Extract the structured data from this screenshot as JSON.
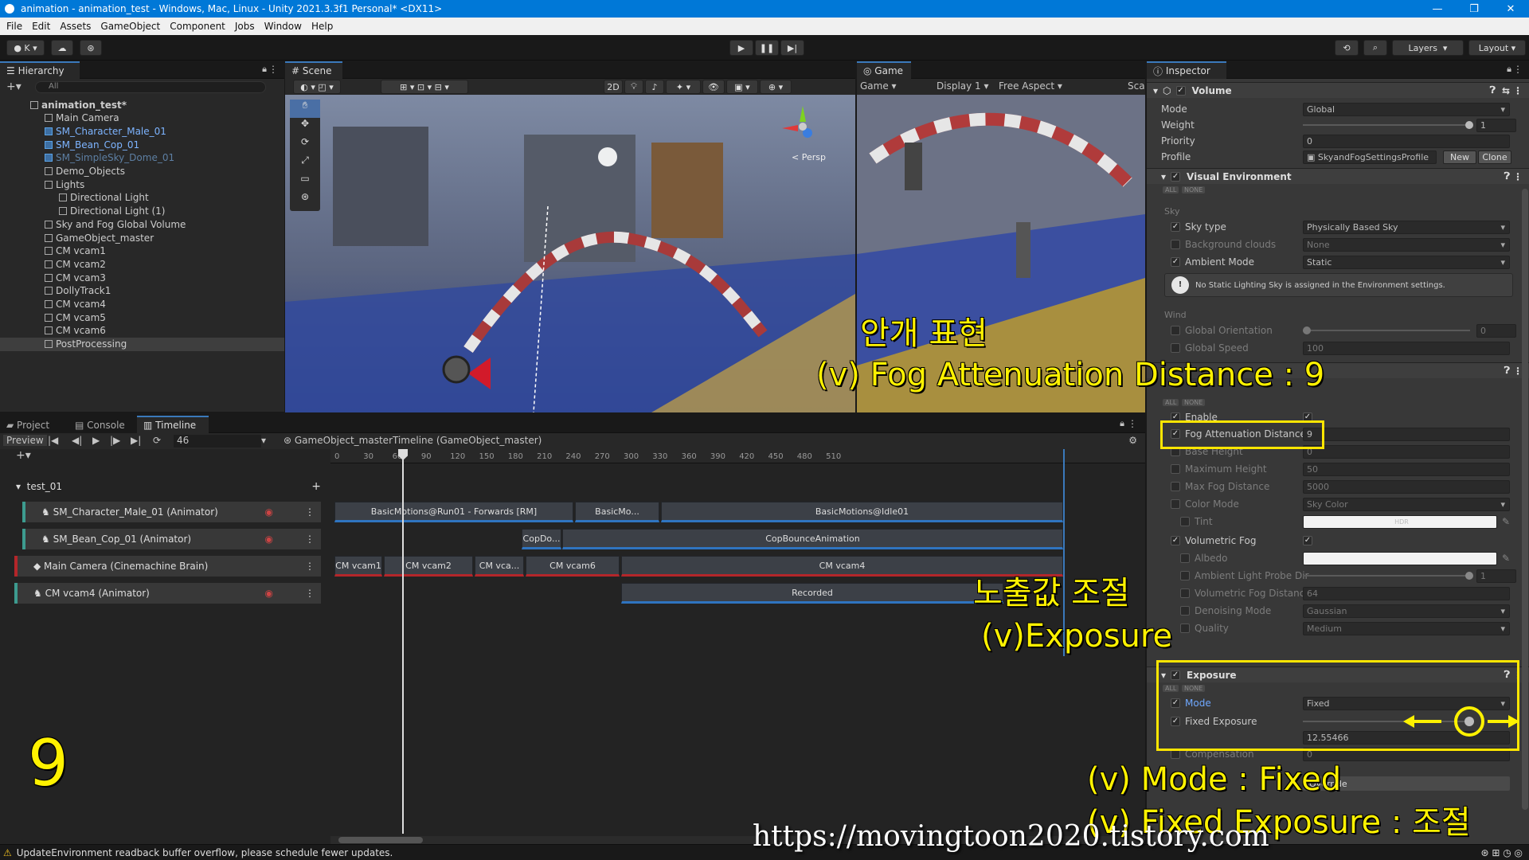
{
  "window": {
    "title": "animation - animation_test - Windows, Mac, Linux - Unity 2021.3.3f1 Personal* <DX11>"
  },
  "menu": [
    "File",
    "Edit",
    "Assets",
    "GameObject",
    "Component",
    "Jobs",
    "Window",
    "Help"
  ],
  "toolbar": {
    "account": "K",
    "layers": "Layers",
    "layout": "Layout"
  },
  "hierarchy": {
    "tab": "Hierarchy",
    "search_placeholder": "All",
    "items": [
      {
        "label": "animation_test*",
        "depth": 0,
        "kind": "scene"
      },
      {
        "label": "Main Camera",
        "depth": 1,
        "kind": "object"
      },
      {
        "label": "SM_Character_Male_01",
        "depth": 1,
        "kind": "prefab"
      },
      {
        "label": "SM_Bean_Cop_01",
        "depth": 1,
        "kind": "prefab"
      },
      {
        "label": "SM_SimpleSky_Dome_01",
        "depth": 1,
        "kind": "faded"
      },
      {
        "label": "Demo_Objects",
        "depth": 1,
        "kind": "object"
      },
      {
        "label": "Lights",
        "depth": 1,
        "kind": "object"
      },
      {
        "label": "Directional Light",
        "depth": 2,
        "kind": "object"
      },
      {
        "label": "Directional Light (1)",
        "depth": 2,
        "kind": "object"
      },
      {
        "label": "Sky and Fog Global Volume",
        "depth": 1,
        "kind": "object"
      },
      {
        "label": "GameObject_master",
        "depth": 1,
        "kind": "object"
      },
      {
        "label": "CM vcam1",
        "depth": 1,
        "kind": "object"
      },
      {
        "label": "CM vcam2",
        "depth": 1,
        "kind": "object"
      },
      {
        "label": "CM vcam3",
        "depth": 1,
        "kind": "object"
      },
      {
        "label": "DollyTrack1",
        "depth": 1,
        "kind": "object"
      },
      {
        "label": "CM vcam4",
        "depth": 1,
        "kind": "object"
      },
      {
        "label": "CM vcam5",
        "depth": 1,
        "kind": "object"
      },
      {
        "label": "CM vcam6",
        "depth": 1,
        "kind": "object"
      },
      {
        "label": "PostProcessing",
        "depth": 1,
        "kind": "selected"
      }
    ]
  },
  "scene": {
    "tab": "Scene",
    "mode_2d": "2D",
    "persp": "< Persp"
  },
  "game": {
    "tab": "Game",
    "view": "Game",
    "display": "Display 1",
    "aspect": "Free Aspect",
    "scale": "Sca"
  },
  "inspector": {
    "tab": "Inspector",
    "component": "Volume",
    "mode_label": "Mode",
    "mode_value": "Global",
    "weight_label": "Weight",
    "weight_value": "1",
    "priority_label": "Priority",
    "priority_value": "0",
    "profile_label": "Profile",
    "profile_value": "SkyandFogSettingsProfile",
    "new_btn": "New",
    "clone_btn": "Clone",
    "visual_env": "Visual Environment",
    "all": "ALL",
    "none": "NONE",
    "sky_header": "Sky",
    "sky_type_label": "Sky type",
    "sky_type_value": "Physically Based Sky",
    "bg_clouds_label": "Background clouds",
    "bg_clouds_value": "None",
    "ambient_label": "Ambient Mode",
    "ambient_value": "Static",
    "warning": "No Static Lighting Sky is assigned in the Environment settings.",
    "wind_header": "Wind",
    "global_orientation_label": "Global Orientation",
    "global_orientation_value": "0",
    "global_speed_label": "Global Speed",
    "global_speed_value": "100",
    "fog_enable_label": "Enable",
    "fog_atten_label": "Fog Attenuation Distance",
    "fog_atten_value": "9",
    "base_height_label": "Base Height",
    "base_height_value": "0",
    "max_height_label": "Maximum Height",
    "max_height_value": "50",
    "max_fog_label": "Max Fog Distance",
    "max_fog_value": "5000",
    "color_mode_label": "Color Mode",
    "color_mode_value": "Sky Color",
    "tint_label": "Tint",
    "tint_value": "HDR",
    "vol_fog_label": "Volumetric Fog",
    "albedo_label": "Albedo",
    "ambient_probe_label": "Ambient Light Probe Dir",
    "ambient_probe_value": "1",
    "vol_fog_dist_label": "Volumetric Fog Distanc",
    "vol_fog_dist_value": "64",
    "denoise_label": "Denoising Mode",
    "denoise_value": "Gaussian",
    "quality_label": "Quality",
    "quality_value": "Medium",
    "exposure_header": "Exposure",
    "exp_mode_label": "Mode",
    "exp_mode_value": "Fixed",
    "fixed_exp_label": "Fixed Exposure",
    "fixed_exp_value": "12.55466",
    "compensation_label": "Compensation",
    "compensation_value": "0",
    "override_text": "Override"
  },
  "timeline": {
    "tabs": [
      "Project",
      "Console",
      "Timeline"
    ],
    "preview": "Preview",
    "frame": "46",
    "asset": "GameObject_masterTimeline (GameObject_master)",
    "group": "test_01",
    "ruler": [
      "0",
      "30",
      "60",
      "90",
      "120",
      "150",
      "180",
      "210",
      "240",
      "270",
      "300",
      "330",
      "360",
      "390",
      "420",
      "450",
      "480",
      "510"
    ],
    "tracks": [
      {
        "label": "SM_Character_Male_01 (Animator)"
      },
      {
        "label": "SM_Bean_Cop_01 (Animator)"
      },
      {
        "label": "Main Camera (Cinemachine Brain)"
      },
      {
        "label": "CM vcam4 (Animator)"
      }
    ],
    "clips": {
      "run": "BasicMotions@Run01 - Forwards [RM]",
      "basicmo": "BasicMo...",
      "idle": "BasicMotions@Idle01",
      "copdo": "CopDo...",
      "copbounce": "CopBounceAnimation",
      "vcam1": "CM vcam1",
      "vcam2": "CM vcam2",
      "vca": "CM vca...",
      "vcam6": "CM vcam6",
      "vcam4": "CM vcam4",
      "recorded": "Recorded"
    }
  },
  "status": {
    "message": "UpdateEnvironment readback buffer overflow, please schedule fewer updates."
  },
  "annotations": {
    "fog_title": "안개 표현",
    "fog_line": "(v) Fog Attenuation Distance : 9",
    "exp_title": "노출값 조절",
    "exp_line": "(v)Exposure",
    "mode_line": "(v) Mode : Fixed",
    "fixed_line": "(v) Fixed Exposure : 조절",
    "step_number": "9",
    "url": "https://movingtoon2020.tistory.com"
  },
  "colors": {
    "accent": "#0078d7",
    "annotation": "#fff200",
    "clip_blue": "#2f74c0",
    "clip_red": "#b4262a"
  }
}
